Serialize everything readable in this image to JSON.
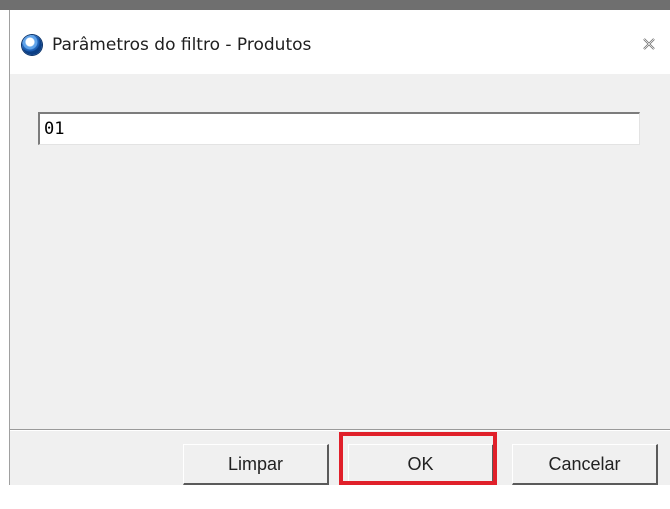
{
  "dialog": {
    "title": "Parâmetros do filtro - Produtos",
    "close_glyph": "⨯",
    "app_icon": "app-globe-icon"
  },
  "filter": {
    "value": "01"
  },
  "buttons": {
    "clear_label": "Limpar",
    "ok_label": "OK",
    "cancel_label": "Cancelar"
  },
  "highlight": {
    "color": "#e0202a",
    "target": "ok-button"
  }
}
